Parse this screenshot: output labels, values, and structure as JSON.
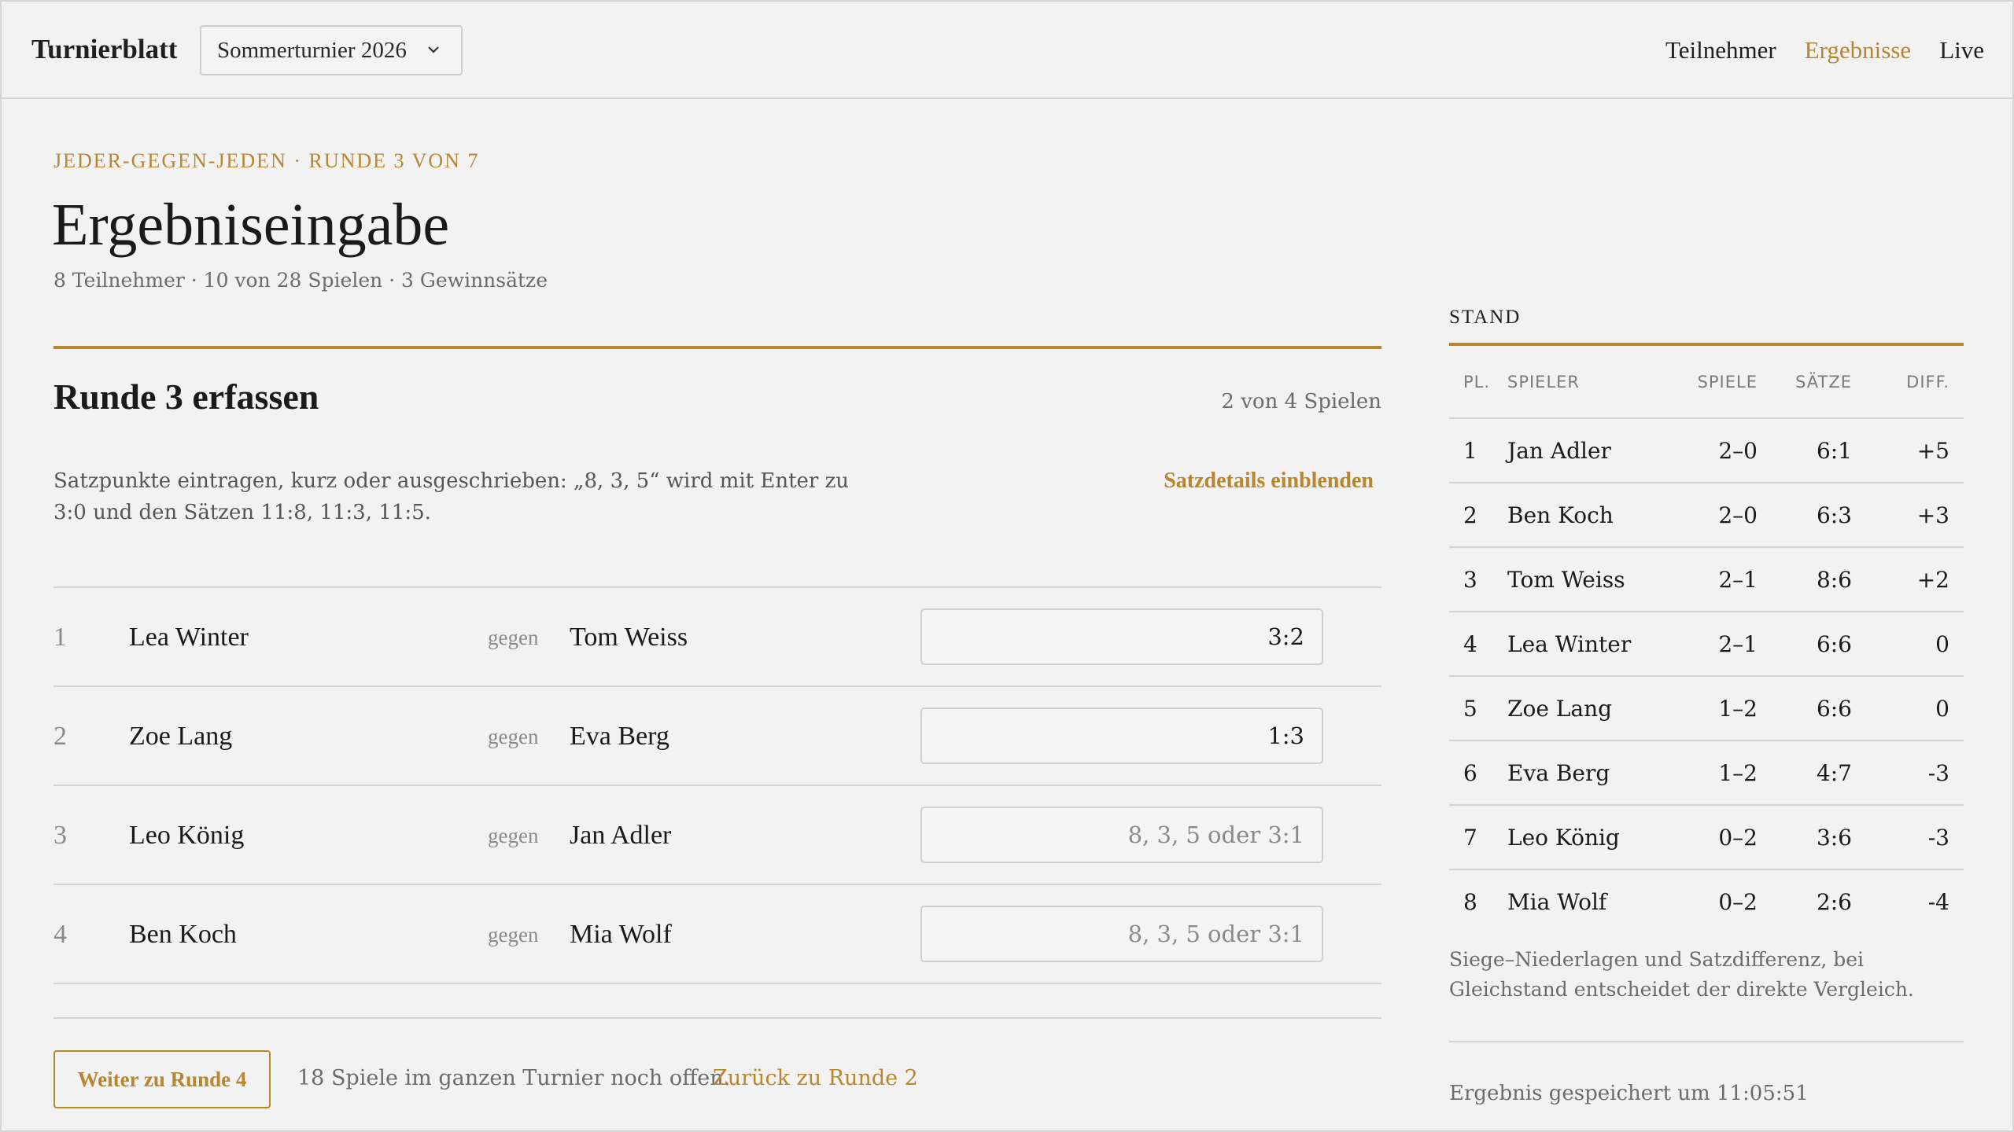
{
  "app": {
    "brand": "Turnierblatt",
    "tournament_select": "Sommerturnier 2026",
    "nav": [
      {
        "label": "Teilnehmer",
        "active": false
      },
      {
        "label": "Ergebnisse",
        "active": true
      },
      {
        "label": "Live",
        "active": false
      }
    ]
  },
  "intro": {
    "eyebrow": "Jeder-gegen-jeden · Runde 3 von 7",
    "title": "Ergebniseingabe",
    "meta": "8 Teilnehmer · 10 von 28 Spielen · 3 Gewinnsätze"
  },
  "round": {
    "title": "Runde 3 erfassen",
    "count": "2 von 4 Spielen",
    "hint": "Satzpunkte eintragen, kurz oder ausgeschrieben: „8, 3, 5“ wird mit Enter zu 3:0 und den Sätzen 11:8, 11:3, 11:5.",
    "details_toggle": "Satzdetails einblenden",
    "vs_label": "gegen",
    "input_placeholder": "8, 3, 5 oder 3:1",
    "matches": [
      {
        "num": "1",
        "player1": "Lea Winter",
        "player2": "Tom Weiss",
        "result": "3:2"
      },
      {
        "num": "2",
        "player1": "Zoe Lang",
        "player2": "Eva Berg",
        "result": "1:3"
      },
      {
        "num": "3",
        "player1": "Leo König",
        "player2": "Jan Adler",
        "result": ""
      },
      {
        "num": "4",
        "player1": "Ben Koch",
        "player2": "Mia Wolf",
        "result": ""
      }
    ],
    "next_button": "Weiter zu Runde 4",
    "open_games": "18 Spiele im ganzen Turnier noch offen.",
    "back_link": "Zurück zu Runde 2"
  },
  "standings": {
    "label": "STAND",
    "columns": [
      "PL.",
      "SPIELER",
      "SPIELE",
      "SÄTZE",
      "DIFF."
    ],
    "rows": [
      [
        "1",
        "Jan Adler",
        "2–0",
        "6:1",
        "+5"
      ],
      [
        "2",
        "Ben Koch",
        "2–0",
        "6:3",
        "+3"
      ],
      [
        "3",
        "Tom Weiss",
        "2–1",
        "8:6",
        "+2"
      ],
      [
        "4",
        "Lea Winter",
        "2–1",
        "6:6",
        "0"
      ],
      [
        "5",
        "Zoe Lang",
        "1–2",
        "6:6",
        "0"
      ],
      [
        "6",
        "Eva Berg",
        "1–2",
        "4:7",
        "-3"
      ],
      [
        "7",
        "Leo König",
        "0–2",
        "3:6",
        "-3"
      ],
      [
        "8",
        "Mia Wolf",
        "0–2",
        "2:6",
        "-4"
      ]
    ],
    "note": "Siege–Niederlagen und Satzdifferenz, bei Gleichstand entscheidet der direkte Vergleich.",
    "saved": "Ergebnis gespeichert um 11:05:51"
  }
}
